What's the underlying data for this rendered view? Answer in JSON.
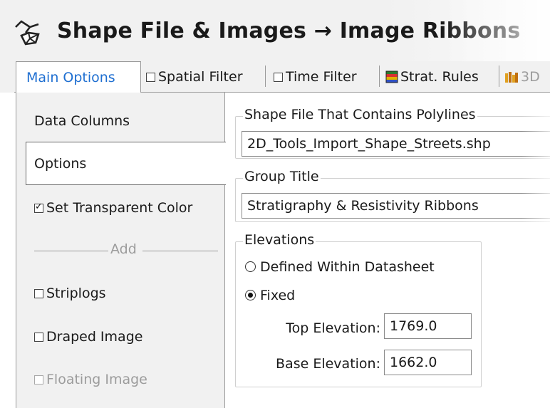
{
  "header": {
    "title": "Shape File & Images → Image Ribbons",
    "icon": "shapefile-polyline-icon"
  },
  "tabs": [
    {
      "label": "Main Options",
      "type": "plain",
      "active": true
    },
    {
      "label": "Spatial Filter",
      "type": "checkbox",
      "checked": false
    },
    {
      "label": "Time Filter",
      "type": "checkbox",
      "checked": false
    },
    {
      "label": "Strat. Rules",
      "type": "icon",
      "icon": "strat-rules-icon"
    },
    {
      "label": "3D",
      "type": "icon",
      "icon": "3d-icon"
    }
  ],
  "left_nav": {
    "data_columns": "Data Columns",
    "options": "Options",
    "set_transparent_color": {
      "label": "Set Transparent Color",
      "checked": true
    },
    "add_separator": "Add",
    "striplogs": {
      "label": "Striplogs",
      "checked": false
    },
    "draped_image": {
      "label": "Draped Image",
      "checked": false
    },
    "floating_image": {
      "label": "Floating Image",
      "checked": false,
      "enabled": false
    }
  },
  "shape_file": {
    "group_title": "Shape File That Contains Polylines",
    "value": "2D_Tools_Import_Shape_Streets.shp"
  },
  "group_title": {
    "group_title": "Group Title",
    "value": "Stratigraphy & Resistivity Ribbons"
  },
  "elevations": {
    "group_title": "Elevations",
    "defined_within_datasheet": {
      "label": "Defined Within Datasheet",
      "selected": false
    },
    "fixed": {
      "label": "Fixed",
      "selected": true
    },
    "top_elevation": {
      "label": "Top Elevation:",
      "value": "1769.0"
    },
    "base_elevation": {
      "label": "Base Elevation:",
      "value": "1662.0"
    }
  },
  "colors": {
    "accent": "#1f6fd1",
    "panel_bg": "#f1f1f1",
    "disabled_text": "#9c9c9c"
  }
}
